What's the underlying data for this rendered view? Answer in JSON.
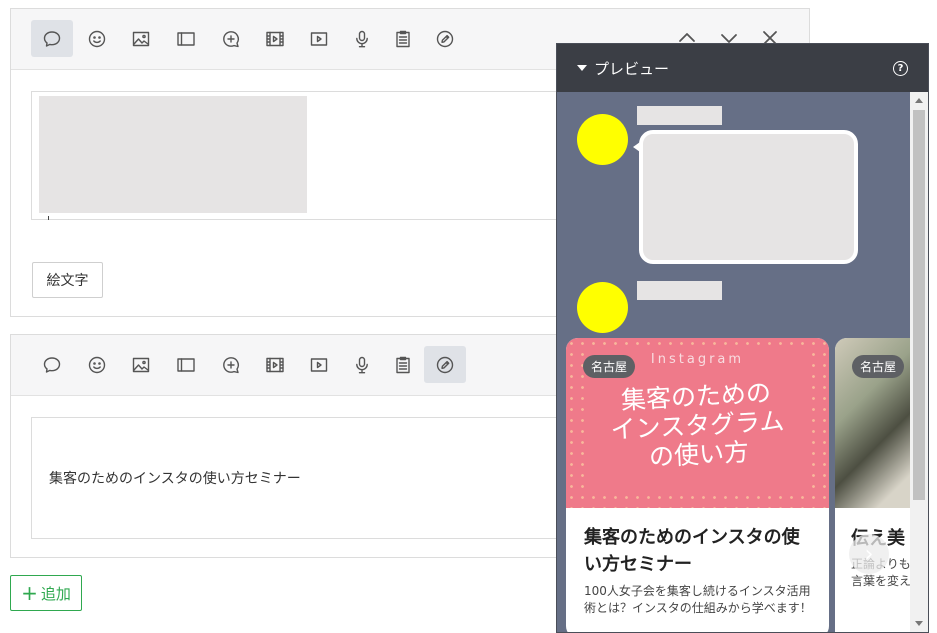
{
  "toolbar_icons": [
    "text-bubble-icon",
    "emoji-face-icon",
    "image-icon",
    "card-icon",
    "add-bubble-icon",
    "video-icon",
    "play-icon",
    "microphone-icon",
    "clipboard-icon",
    "edit-badge-icon"
  ],
  "block1": {
    "active_tool": "text-bubble-icon",
    "emoji_button": "絵文字",
    "controls": [
      "chevron-up-icon",
      "chevron-down-icon",
      "close-icon"
    ]
  },
  "block2": {
    "active_tool": "edit-badge-icon",
    "text": "集客のためのインスタの使い方セミナー"
  },
  "add_button": "追加",
  "preview": {
    "title": "プレビュー",
    "help": "?",
    "cards": [
      {
        "tag": "名古屋",
        "hero_top": "Instagram",
        "hero_lines": [
          "集客のための",
          "インスタグラム",
          "の使い方"
        ],
        "title": "集客のためのインスタの使い方セミナー",
        "description": "100人女子会を集客し続けるインスタ活用術とは？インスタの仕組みから学べます！"
      },
      {
        "tag": "名古屋",
        "title": "伝え美",
        "description_lines": [
          "正論よりも",
          "言葉を変え"
        ]
      }
    ]
  },
  "colors": {
    "accent_green": "#2fa84f",
    "preview_bg": "#666f86",
    "preview_header": "#3b3e45",
    "avatar": "#ffff00",
    "card_hero": "#ef7a8a"
  }
}
